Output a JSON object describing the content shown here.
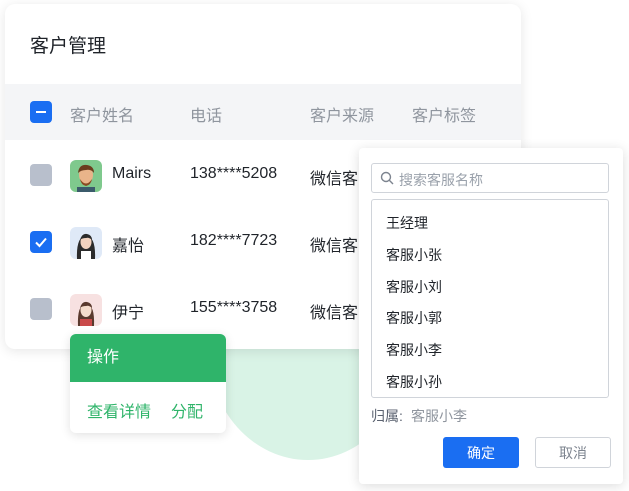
{
  "card": {
    "title": "客户管理",
    "columns": [
      "客户姓名",
      "电话",
      "客户来源",
      "客户标签"
    ],
    "rows": [
      {
        "name": "Mairs",
        "phone": "138****5208",
        "source": "微信客",
        "checked": false
      },
      {
        "name": "嘉怡",
        "phone": "182****7723",
        "source": "微信客",
        "checked": true
      },
      {
        "name": "伊宁",
        "phone": "155****3758",
        "source": "微信客",
        "checked": false
      }
    ]
  },
  "ops": {
    "header": "操作",
    "view_label": "查看详情",
    "assign_label": "分配"
  },
  "popup": {
    "search_placeholder": "搜索客服名称",
    "options": [
      "王经理",
      "客服小张",
      "客服小刘",
      "客服小郭",
      "客服小李",
      "客服小孙"
    ],
    "assigned_label": "归属:",
    "assigned_value": "客服小李",
    "confirm_label": "确定",
    "cancel_label": "取消"
  },
  "colors": {
    "primary_blue": "#1a6ef2",
    "green": "#2fb46a",
    "checkbox_gray": "#b8bfcc"
  }
}
